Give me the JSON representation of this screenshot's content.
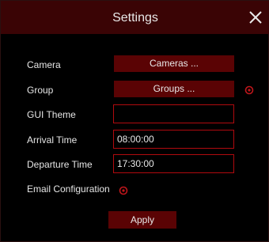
{
  "window": {
    "title": "Settings",
    "close_icon": "close-icon"
  },
  "rows": {
    "camera": {
      "label": "Camera",
      "button": "Cameras ..."
    },
    "group": {
      "label": "Group",
      "button": "Groups ...",
      "icon": "gear-icon"
    },
    "gui_theme": {
      "label": "GUI Theme",
      "value": ""
    },
    "arrival_time": {
      "label": "Arrival Time",
      "value": "08:00:00"
    },
    "departure_time": {
      "label": "Departure Time",
      "value": "17:30:00"
    },
    "email_configuration": {
      "label": "Email Configuration",
      "icon": "gear-icon"
    }
  },
  "footer": {
    "apply_label": "Apply"
  },
  "colors": {
    "titlebar": "#3a0405",
    "button": "#5a0304",
    "accent_border": "#b00a0e",
    "gear": "#c0161b"
  }
}
